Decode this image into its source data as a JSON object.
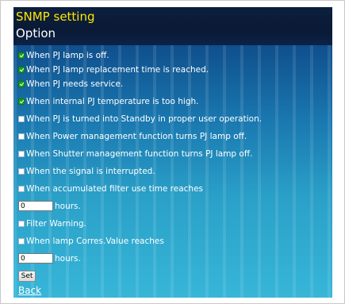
{
  "header": {
    "title": "SNMP setting",
    "subtitle": "Option"
  },
  "options": [
    {
      "label": "When PJ lamp is off.",
      "checked": true
    },
    {
      "label": "When PJ lamp replacement time is reached.",
      "checked": true
    },
    {
      "label": "When PJ needs service.",
      "checked": true
    },
    {
      "label": "When internal PJ temperature is too high.",
      "checked": true
    },
    {
      "label": "When PJ is turned into Standby in proper user operation.",
      "checked": false
    },
    {
      "label": "When Power management function turns PJ lamp off.",
      "checked": false
    },
    {
      "label": "When Shutter management function turns PJ lamp off.",
      "checked": false
    },
    {
      "label": "When the signal is interrupted.",
      "checked": false
    },
    {
      "label": "When accumulated filter use time reaches",
      "checked": false
    }
  ],
  "filter_hours": {
    "value": "0",
    "unit": "hours."
  },
  "filter_warning": {
    "label": "Filter Warning.",
    "checked": false
  },
  "lamp_corres": {
    "label": "When lamp Corres.Value reaches",
    "checked": false
  },
  "lamp_hours": {
    "value": "0",
    "unit": "hours."
  },
  "set_button": "Set",
  "back_link": "Back",
  "colors": {
    "title": "#ffe600",
    "checked": "#16a416",
    "header_bg": "#0b1f3d",
    "panel_bg": "#1a78b0"
  }
}
